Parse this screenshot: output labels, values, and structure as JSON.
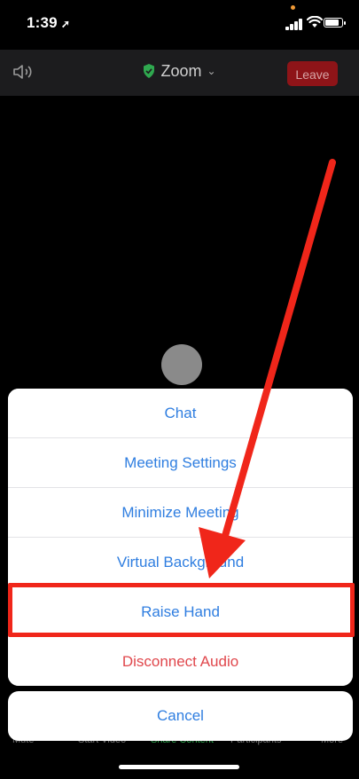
{
  "status_bar": {
    "time": "1:39",
    "location_glyph": "➚"
  },
  "top_bar": {
    "title": "Zoom",
    "title_chevron": "⌄",
    "leave_label": "Leave"
  },
  "menu": {
    "items": [
      {
        "label": "Chat"
      },
      {
        "label": "Meeting Settings"
      },
      {
        "label": "Minimize Meeting"
      },
      {
        "label": "Virtual Background"
      },
      {
        "label": "Raise Hand"
      },
      {
        "label": "Disconnect Audio"
      }
    ],
    "cancel_label": "Cancel"
  },
  "bottom_toolbar": {
    "items": [
      "Mute",
      "Start Video",
      "Share Content",
      "Participants",
      "More"
    ]
  },
  "colors": {
    "action_blue": "#2f7ee0",
    "destructive_red": "#e0474c",
    "leave_button": "#8e1418",
    "annotation_red": "#f0261a",
    "shield_green": "#2fa84f"
  }
}
